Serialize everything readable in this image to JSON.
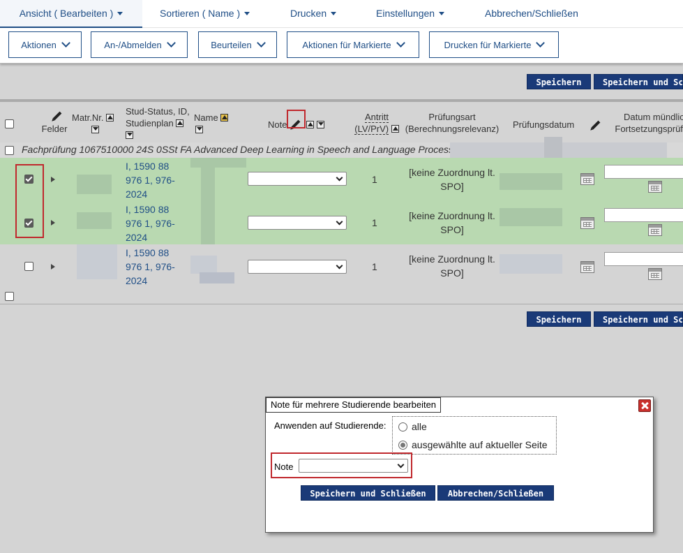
{
  "topmenu": {
    "view": "Ansicht ( Bearbeiten )",
    "sort": "Sortieren ( Name )",
    "print": "Drucken",
    "settings": "Einstellungen",
    "cancel": "Abbrechen/Schließen"
  },
  "actionbar": {
    "actions": "Aktionen",
    "register": "An-/Abmelden",
    "grade": "Beurteilen",
    "marked_actions": "Aktionen für Markierte",
    "marked_print": "Drucken für Markierte"
  },
  "buttons": {
    "save": "Speichern",
    "save_close": "Speichern und Schließen"
  },
  "table": {
    "headers": {
      "fields": "Felder",
      "matr": "Matr.Nr.",
      "status": [
        "Stud-Status, ID,",
        "Studienplan"
      ],
      "name": "Name",
      "note": "Note",
      "antritt": [
        "Antritt",
        "(LV/PrV)"
      ],
      "pruefungsart": [
        "Prüfungsart",
        "(Berechnungsrelevanz)"
      ],
      "pruefungsdatum": "Prüfungsdatum",
      "datum_muendlich": [
        "Datum mündlich",
        "Fortsetzungsprüfung"
      ]
    },
    "group_label": "Fachprüfung 1067510000 24S 0SSt FA Advanced Deep Learning in Speech and Language Processing",
    "rows": [
      {
        "checked": true,
        "status": [
          "I, 1590 88",
          "976 1, 976-",
          "2024"
        ],
        "antritt": "1",
        "pruefungsart": [
          "[keine Zuordnung lt.",
          "SPO]"
        ]
      },
      {
        "checked": true,
        "status": [
          "I, 1590 88",
          "976 1, 976-",
          "2024"
        ],
        "antritt": "1",
        "pruefungsart": [
          "[keine Zuordnung lt.",
          "SPO]"
        ]
      },
      {
        "checked": false,
        "status": [
          "I, 1590 88",
          "976 1, 976-",
          "2024"
        ],
        "antritt": "1",
        "pruefungsart": [
          "[keine Zuordnung lt.",
          "SPO]"
        ]
      }
    ]
  },
  "dialog": {
    "title": "Note für mehrere Studierende bearbeiten",
    "apply_label": "Anwenden auf Studierende:",
    "option_all": "alle",
    "option_selected": "ausgewählte auf aktueller Seite",
    "selected_option": "ausgewählte auf aktueller Seite",
    "note_label": "Note",
    "note_value": "",
    "save_close": "Speichern und Schließen",
    "cancel_close": "Abbrechen/Schließen"
  },
  "colors": {
    "accent": "#1f4e86",
    "button_bg": "#1a3a78",
    "selected_row": "#b9d9b1",
    "highlight_red": "#c0282d"
  }
}
